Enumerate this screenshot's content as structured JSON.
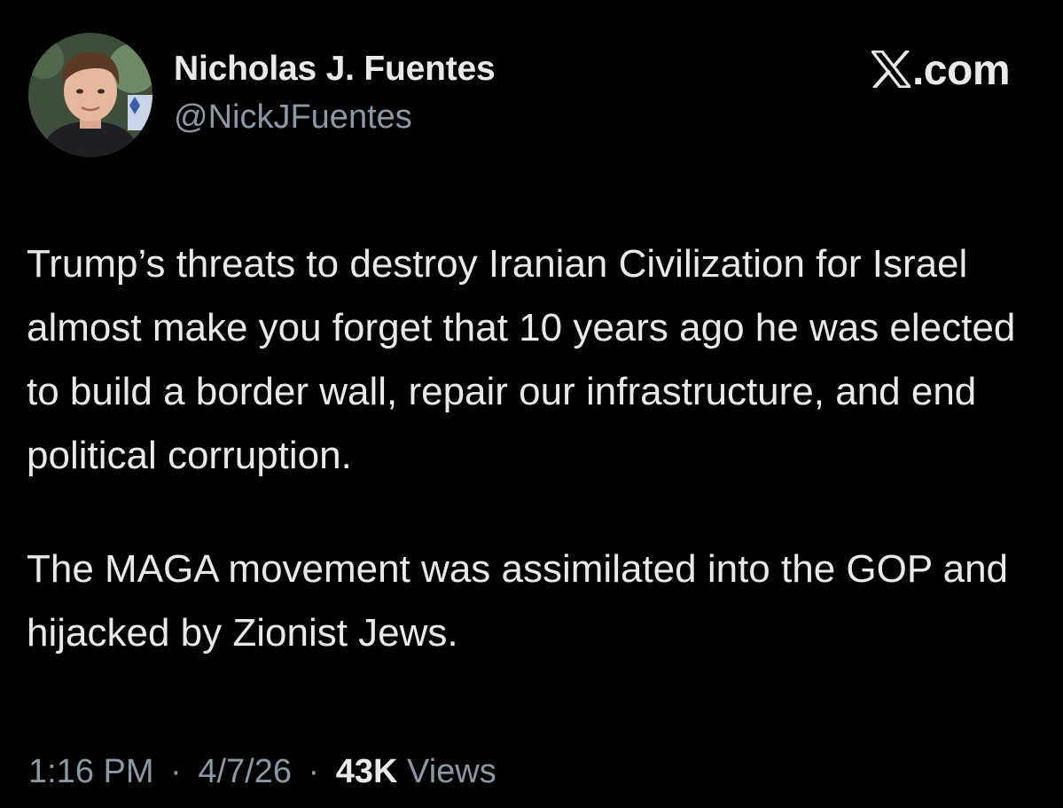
{
  "author": {
    "display_name": "Nicholas J. Fuentes",
    "handle": "@NickJFuentes",
    "avatar_icon": "profile-photo-avatar"
  },
  "brand": {
    "icon": "x-logo-icon",
    "text": ".com"
  },
  "tweet": {
    "paragraphs": [
      "Trump’s threats to destroy Iranian Civilization for Israel almost make you forget that 10 years ago he was elected to build a border wall, repair our infrastructure, and end political corruption.",
      "The MAGA movement was assimilated into the GOP and hijacked by Zionist Jews."
    ]
  },
  "meta": {
    "time": "1:16 PM",
    "date": "4/7/26",
    "separator": "·",
    "views_count": "43K",
    "views_label": "Views"
  },
  "colors": {
    "background": "#000000",
    "primary_text": "#e7e9ea",
    "secondary_text": "#8b98a5"
  }
}
